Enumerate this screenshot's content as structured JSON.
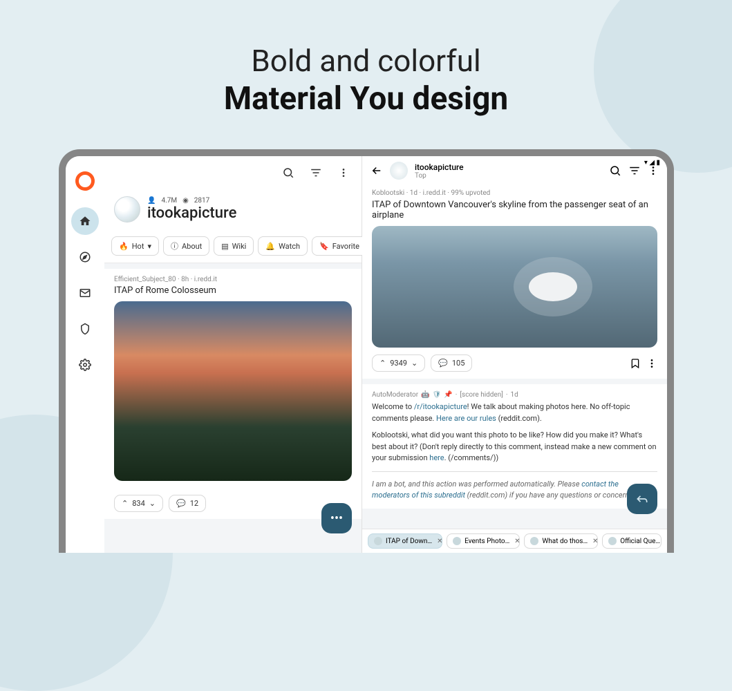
{
  "hero": {
    "line1": "Bold and colorful",
    "line2": "Material You design"
  },
  "leftPane": {
    "sub": {
      "members": "4.7M",
      "online": "2817",
      "name": "itookapicture"
    },
    "chips": {
      "sort": "Hot",
      "about": "About",
      "wiki": "Wiki",
      "watch": "Watch",
      "favorite": "Favorite"
    },
    "post1": {
      "meta": "Efficient_Subject_80 · 8h · i.redd.it",
      "title": "ITAP of Rome Colosseum"
    },
    "footer": {
      "votes": "834",
      "comments": "12"
    }
  },
  "rightPane": {
    "header": {
      "title": "itookapicture",
      "sort": "Top"
    },
    "detail": {
      "meta": "Koblootski · 1d · i.redd.it · 99% upvoted",
      "title": "ITAP of Downtown Vancouver's skyline from the passenger seat of an airplane",
      "votes": "9349",
      "comments": "105"
    },
    "comment": {
      "author": "AutoModerator",
      "score": "[score hidden]",
      "time": "1d",
      "welcome_pre": "Welcome to ",
      "welcome_link": "/r/itookapicture",
      "welcome_post": "! We talk about making photos here. No off-topic comments please. ",
      "rules_link": "Here are our rules",
      "rules_post": " (reddit.com).",
      "q_pre": "Koblootski, what did you want this photo to be like? How did you make it? What's best about it? (Don't reply directly to this comment, instead make a new comment on your submission ",
      "q_link": "here",
      "q_post": ". (/comments/))",
      "bot_pre": "I am a bot, and this action was performed automatically. Please ",
      "bot_link": "contact the moderators of this subreddit",
      "bot_post": " (reddit.com) if you have any questions or concerns."
    },
    "tabs": {
      "t1": "ITAP of Down…",
      "t2": "Events Photo…",
      "t3": "What do thos…",
      "t4": "Official Que…"
    }
  }
}
